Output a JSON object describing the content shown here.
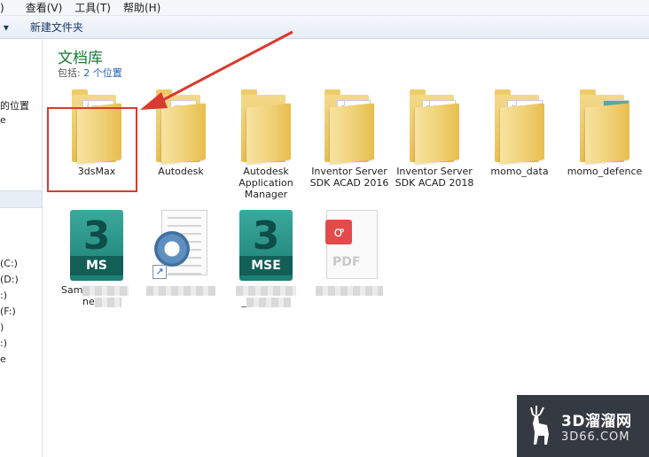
{
  "menubar": {
    "items": [
      ")",
      "查看(V)",
      "工具(T)",
      "帮助(H)"
    ]
  },
  "toolbar": {
    "organize_label": "理 ▾",
    "new_folder_label": "新建文件夹"
  },
  "navpane": {
    "items": [
      "的位置",
      "e",
      "(C:)",
      "(D:)",
      ":)",
      "(F:)",
      ")",
      ":)",
      "e"
    ]
  },
  "library": {
    "title": "文档库",
    "includes_label": "包括:",
    "locations_link": "2 个位置"
  },
  "items": [
    {
      "label": "3dsMax",
      "type": "folder"
    },
    {
      "label": "Autodesk",
      "type": "folder"
    },
    {
      "label": "Autodesk Application Manager",
      "type": "folder"
    },
    {
      "label": "Inventor Server SDK ACAD 2016",
      "type": "folder"
    },
    {
      "label": "Inventor Server SDK ACAD 2018",
      "type": "folder"
    },
    {
      "label": "momo_data",
      "type": "folder"
    },
    {
      "label": "momo_defence",
      "type": "folder"
    },
    {
      "label": "Sam",
      "sublabel": "ne",
      "type": "ms-file",
      "badge": "MS",
      "digit": "3"
    },
    {
      "label": "",
      "type": "config-shortcut"
    },
    {
      "label": "",
      "sublabel": "_",
      "type": "mse-file",
      "badge": "MSE",
      "digit": "3"
    },
    {
      "label": "",
      "type": "pdf-file",
      "badge": "PDF"
    }
  ],
  "watermark": {
    "line1": "3D溜溜网",
    "line2": "3D66.COM"
  },
  "colors": {
    "library_title": "#1a7b36",
    "link": "#1f5fb4",
    "annotation": "#d93a2f",
    "folder": "#efcf72",
    "max_icon": "#1c7d74"
  }
}
